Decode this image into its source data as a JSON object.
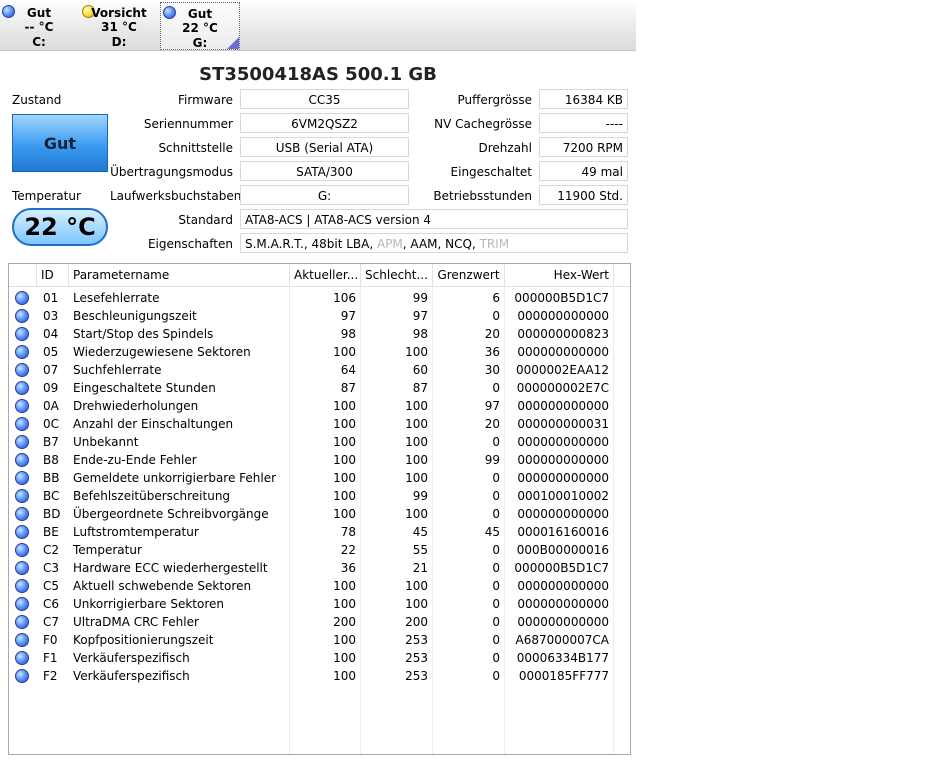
{
  "drives": [
    {
      "status": "Gut",
      "temp": "-- °C",
      "letter": "C:",
      "dot": "blue"
    },
    {
      "status": "Vorsicht",
      "temp": "31 °C",
      "letter": "D:",
      "dot": "yellow"
    },
    {
      "status": "Gut",
      "temp": "22 °C",
      "letter": "G:",
      "dot": "blue"
    }
  ],
  "disk": {
    "title": "ST3500418AS  500.1 GB",
    "zustand_label": "Zustand",
    "zustand_value": "Gut",
    "temperatur_label": "Temperatur",
    "temperatur_value": "22 °C",
    "firmware_label": "Firmware",
    "firmware": "CC35",
    "serial_label": "Seriennummer",
    "serial": "6VM2QSZ2",
    "interface_label": "Schnittstelle",
    "interface": "USB (Serial ATA)",
    "transfer_label": "Übertragungsmodus",
    "transfer": "SATA/300",
    "letters_label": "Laufwerksbuchstaben",
    "letters": "G:",
    "buffer_label": "Puffergrösse",
    "buffer": "16384 KB",
    "nvcache_label": "NV Cachegrösse",
    "nvcache": "----",
    "rpm_label": "Drehzahl",
    "rpm": "7200 RPM",
    "poweron_label": "Eingeschaltet",
    "poweron": "49 mal",
    "hours_label": "Betriebsstunden",
    "hours": "11900 Std.",
    "standard_label": "Standard",
    "standard": "ATA8-ACS | ATA8-ACS version 4",
    "features_label": "Eigenschaften",
    "features_active1": "S.M.A.R.T., 48bit LBA, ",
    "features_inactive1": "APM",
    "features_active2": ", AAM, NCQ, ",
    "features_inactive2": "TRIM"
  },
  "smart_table": {
    "headers": [
      "ID",
      "Parametername",
      "Aktueller...",
      "Schlecht...",
      "Grenzwert",
      "Hex-Wert"
    ],
    "rows": [
      [
        "01",
        "Lesefehlerrate",
        "106",
        "99",
        "6",
        "000000B5D1C7"
      ],
      [
        "03",
        "Beschleunigungszeit",
        "97",
        "97",
        "0",
        "000000000000"
      ],
      [
        "04",
        "Start/Stop des Spindels",
        "98",
        "98",
        "20",
        "000000000823"
      ],
      [
        "05",
        "Wiederzugewiesene Sektoren",
        "100",
        "100",
        "36",
        "000000000000"
      ],
      [
        "07",
        "Suchfehlerrate",
        "64",
        "60",
        "30",
        "0000002EAA12"
      ],
      [
        "09",
        "Eingeschaltete Stunden",
        "87",
        "87",
        "0",
        "000000002E7C"
      ],
      [
        "0A",
        "Drehwiederholungen",
        "100",
        "100",
        "97",
        "000000000000"
      ],
      [
        "0C",
        "Anzahl der Einschaltungen",
        "100",
        "100",
        "20",
        "000000000031"
      ],
      [
        "B7",
        "Unbekannt",
        "100",
        "100",
        "0",
        "000000000000"
      ],
      [
        "B8",
        "Ende-zu-Ende Fehler",
        "100",
        "100",
        "99",
        "000000000000"
      ],
      [
        "BB",
        "Gemeldete unkorrigierbare Fehler",
        "100",
        "100",
        "0",
        "000000000000"
      ],
      [
        "BC",
        "Befehlszeitüberschreitung",
        "100",
        "99",
        "0",
        "000100010002"
      ],
      [
        "BD",
        "Übergeordnete Schreibvorgänge",
        "100",
        "100",
        "0",
        "000000000000"
      ],
      [
        "BE",
        "Luftstromtemperatur",
        "78",
        "45",
        "45",
        "000016160016"
      ],
      [
        "C2",
        "Temperatur",
        "22",
        "55",
        "0",
        "000B00000016"
      ],
      [
        "C3",
        "Hardware ECC wiederhergestellt",
        "36",
        "21",
        "0",
        "000000B5D1C7"
      ],
      [
        "C5",
        "Aktuell schwebende Sektoren",
        "100",
        "100",
        "0",
        "000000000000"
      ],
      [
        "C6",
        "Unkorrigierbare Sektoren",
        "100",
        "100",
        "0",
        "000000000000"
      ],
      [
        "C7",
        "UltraDMA CRC Fehler",
        "200",
        "200",
        "0",
        "000000000000"
      ],
      [
        "F0",
        "Kopfpositionierungszeit",
        "100",
        "253",
        "0",
        "A687000007CA"
      ],
      [
        "F1",
        "Verkäuferspezifisch",
        "100",
        "253",
        "0",
        "00006334B177"
      ],
      [
        "F2",
        "Verkäuferspezifisch",
        "100",
        "253",
        "0",
        "0000185FF777"
      ]
    ]
  }
}
